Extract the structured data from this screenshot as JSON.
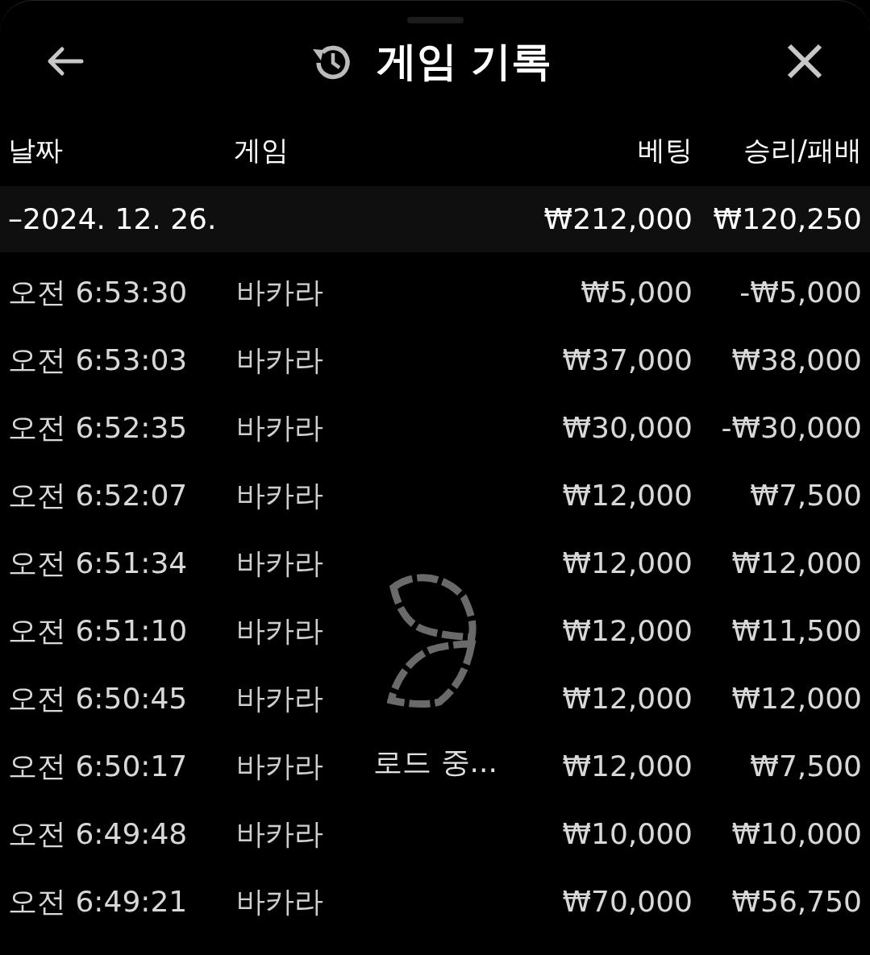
{
  "header": {
    "title": "게임 기록"
  },
  "columns": [
    "날짜",
    "게임",
    "베팅",
    "승리/패배"
  ],
  "group": {
    "date": "–2024. 12. 26.",
    "bet": "₩212,000",
    "result": "₩120,250"
  },
  "rows": [
    {
      "time": "오전 6:53:30",
      "game": "바카라",
      "bet": "₩5,000",
      "result": "-₩5,000"
    },
    {
      "time": "오전 6:53:03",
      "game": "바카라",
      "bet": "₩37,000",
      "result": "₩38,000"
    },
    {
      "time": "오전 6:52:35",
      "game": "바카라",
      "bet": "₩30,000",
      "result": "-₩30,000"
    },
    {
      "time": "오전 6:52:07",
      "game": "바카라",
      "bet": "₩12,000",
      "result": "₩7,500"
    },
    {
      "time": "오전 6:51:34",
      "game": "바카라",
      "bet": "₩12,000",
      "result": "₩12,000"
    },
    {
      "time": "오전 6:51:10",
      "game": "바카라",
      "bet": "₩12,000",
      "result": "₩11,500"
    },
    {
      "time": "오전 6:50:45",
      "game": "바카라",
      "bet": "₩12,000",
      "result": "₩12,000"
    },
    {
      "time": "오전 6:50:17",
      "game": "바카라",
      "bet": "₩12,000",
      "result": "₩7,500"
    },
    {
      "time": "오전 6:49:48",
      "game": "바카라",
      "bet": "₩10,000",
      "result": "₩10,000"
    },
    {
      "time": "오전 6:49:21",
      "game": "바카라",
      "bet": "₩70,000",
      "result": "₩56,750"
    }
  ],
  "loading": {
    "text": "로드 중..."
  }
}
